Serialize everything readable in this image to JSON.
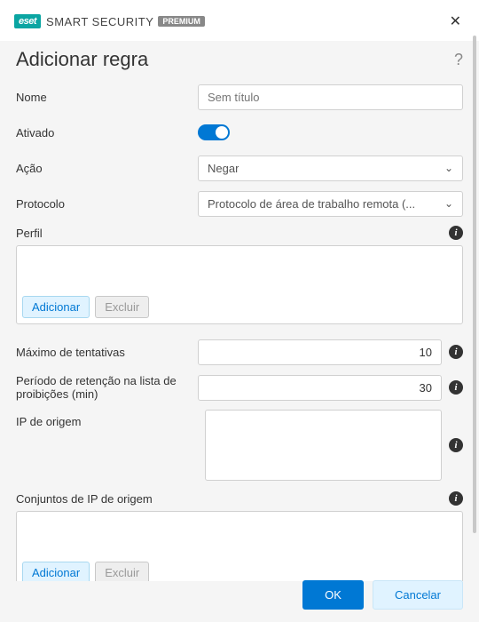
{
  "header": {
    "brand_badge": "eset",
    "brand_text": "SMART SECURITY",
    "brand_tier": "PREMIUM"
  },
  "dialog": {
    "title": "Adicionar regra",
    "help_symbol": "?"
  },
  "form": {
    "name_label": "Nome",
    "name_placeholder": "Sem título",
    "enabled_label": "Ativado",
    "action_label": "Ação",
    "action_value": "Negar",
    "protocol_label": "Protocolo",
    "protocol_value": "Protocolo de área de trabalho remota (...",
    "profile_label": "Perfil",
    "max_attempts_label": "Máximo de tentativas",
    "max_attempts_value": "10",
    "retention_label": "Período de retenção na lista de proibições (min)",
    "retention_value": "30",
    "source_ip_label": "IP de origem",
    "source_ip_sets_label": "Conjuntos de IP de origem"
  },
  "buttons": {
    "add": "Adicionar",
    "delete": "Excluir",
    "ok": "OK",
    "cancel": "Cancelar"
  },
  "icons": {
    "info": "i"
  }
}
